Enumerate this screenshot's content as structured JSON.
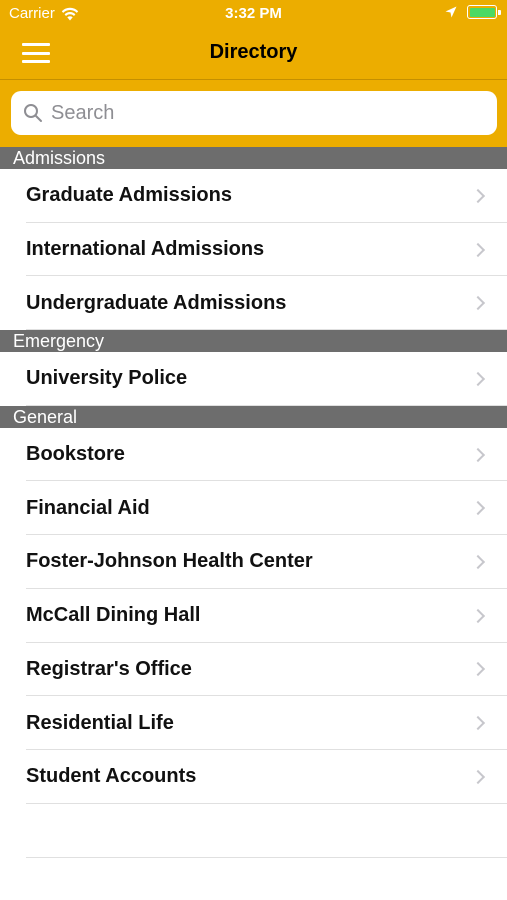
{
  "status": {
    "carrier": "Carrier",
    "time": "3:32 PM"
  },
  "navbar": {
    "title": "Directory"
  },
  "search": {
    "placeholder": "Search"
  },
  "sections": [
    {
      "title": "Admissions",
      "items": [
        "Graduate Admissions",
        "International Admissions",
        "Undergraduate Admissions"
      ]
    },
    {
      "title": "Emergency",
      "items": [
        "University Police"
      ]
    },
    {
      "title": "General",
      "items": [
        "Bookstore",
        "Financial Aid",
        "Foster-Johnson Health Center",
        "McCall Dining Hall",
        "Registrar's Office",
        "Residential Life",
        "Student Accounts"
      ]
    }
  ],
  "colors": {
    "accent": "#ecad00",
    "section_header": "#6d6d6d",
    "battery": "#4cd964"
  },
  "icons": [
    "wifi-icon",
    "location-arrow-icon",
    "battery-icon",
    "menu-icon",
    "search-icon",
    "chevron-right-icon"
  ]
}
